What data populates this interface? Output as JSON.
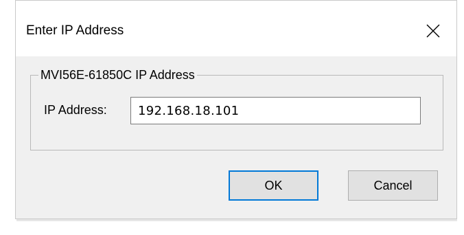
{
  "dialog": {
    "title": "Enter IP Address",
    "close_icon": "close-icon"
  },
  "group": {
    "legend": "MVI56E-61850C IP Address",
    "ip_label": "IP Address:",
    "ip_value": "192.168.18.101"
  },
  "buttons": {
    "ok_label": "OK",
    "cancel_label": "Cancel"
  },
  "colors": {
    "dialog_bg": "#f0f0f0",
    "title_bar_bg": "#ffffff",
    "default_button_border": "#0078d7",
    "button_bg": "#e1e1e1"
  }
}
